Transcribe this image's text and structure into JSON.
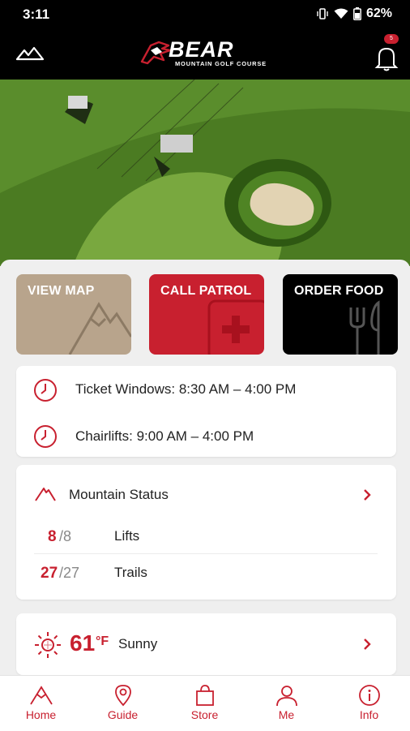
{
  "status_bar": {
    "time": "3:11",
    "battery": "62%"
  },
  "brand": {
    "name": "BEAR",
    "subtitle": "MOUNTAIN GOLF COURSE",
    "notification_count": "5"
  },
  "tiles": [
    {
      "label": "VIEW MAP",
      "color": "#b8a48c"
    },
    {
      "label": "CALL PATROL",
      "color": "#c8202f"
    },
    {
      "label": "ORDER FOOD",
      "color": "#000000"
    }
  ],
  "hours": [
    {
      "label": "Ticket Windows: 8:30 AM – 4:00 PM"
    },
    {
      "label": "Chairlifts: 9:00 AM – 4:00 PM"
    }
  ],
  "mountain_status": {
    "title": "Mountain Status",
    "lifts": {
      "open": "8",
      "total": "/8",
      "label": "Lifts"
    },
    "trails": {
      "open": "27",
      "total": "/27",
      "label": "Trails"
    }
  },
  "weather": {
    "temp": "61",
    "unit": "°F",
    "condition": "Sunny"
  },
  "tabs": [
    {
      "label": "Home"
    },
    {
      "label": "Guide"
    },
    {
      "label": "Store"
    },
    {
      "label": "Me"
    },
    {
      "label": "Info"
    }
  ],
  "colors": {
    "accent": "#c8202f",
    "header_bg": "#000000"
  }
}
